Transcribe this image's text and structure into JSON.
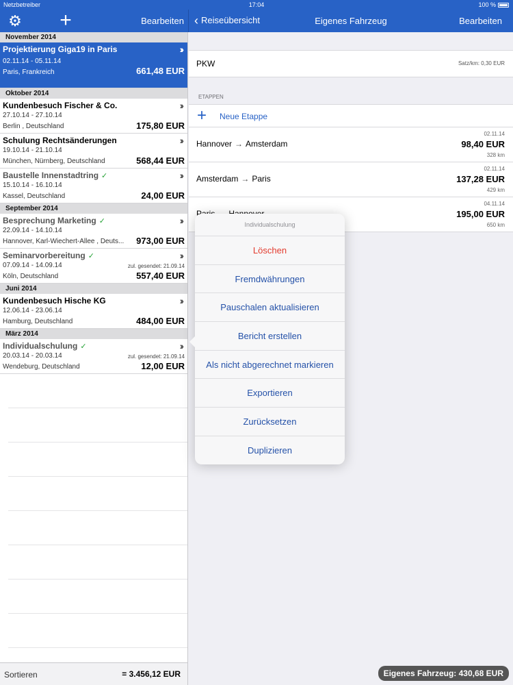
{
  "statusbar": {
    "carrier": "Netzbetreiber",
    "time": "17:04",
    "battery": "100 %"
  },
  "left_nav": {
    "edit_label": "Bearbeiten"
  },
  "right_nav": {
    "back_label": "Reiseübersicht",
    "title": "Eigenes Fahrzeug",
    "edit_label": "Bearbeiten"
  },
  "trips": {
    "sections": [
      {
        "header": "November 2014",
        "items": [
          {
            "title": "Projektierung Giga19 in Paris",
            "dates": "02.11.14 - 05.11.14",
            "place": "Paris, Frankreich",
            "amount": "661,48 EUR",
            "selected": true
          }
        ]
      },
      {
        "header": "Oktober 2014",
        "items": [
          {
            "title": "Kundenbesuch Fischer & Co.",
            "dates": "27.10.14 - 27.10.14",
            "place": "Berlin , Deutschland",
            "amount": "175,80 EUR"
          },
          {
            "title": "Schulung Rechtsänderungen",
            "dates": "19.10.14 - 21.10.14",
            "place": "München, Nürnberg, Deutschland",
            "amount": "568,44 EUR"
          },
          {
            "title": "Baustelle Innenstadtring",
            "dates": "15.10.14 - 16.10.14",
            "place": "Kassel, Deutschland",
            "amount": "24,00 EUR",
            "check": true
          }
        ]
      },
      {
        "header": "September 2014",
        "items": [
          {
            "title": "Besprechung Marketing",
            "dates": "22.09.14 - 14.10.14",
            "place": "Hannover, Karl-Wiechert-Allee , Deuts...",
            "amount": "973,00 EUR",
            "check": true
          },
          {
            "title": "Seminarvorbereitung",
            "dates": "07.09.14 - 14.09.14",
            "place": "Köln, Deutschland",
            "amount": "557,40 EUR",
            "check": true,
            "sent": "zul. gesendet: 21.09.14"
          }
        ]
      },
      {
        "header": "Juni 2014",
        "items": [
          {
            "title": "Kundenbesuch Hische KG",
            "dates": "12.06.14 - 23.06.14",
            "place": "Hamburg, Deutschland",
            "amount": "484,00 EUR"
          }
        ]
      },
      {
        "header": "März 2014",
        "items": [
          {
            "title": "Individualschulung",
            "dates": "20.03.14 - 20.03.14",
            "place": "Wendeburg, Deutschland",
            "amount": "12,00 EUR",
            "check": true,
            "sent": "zul. gesendet: 21.09.14"
          }
        ]
      }
    ]
  },
  "left_footer": {
    "sort_label": "Sortieren",
    "total": "= 3.456,12 EUR"
  },
  "vehicle": {
    "name": "PKW",
    "rate": "Satz/km: 0,30 EUR"
  },
  "stages": {
    "header": "ETAPPEN",
    "new_label": "Neue Etappe",
    "items": [
      {
        "from": "Hannover",
        "to": "Amsterdam",
        "date": "02.11.14",
        "amount": "98,40 EUR",
        "km": "328 km"
      },
      {
        "from": "Amsterdam",
        "to": "Paris",
        "date": "02.11.14",
        "amount": "137,28 EUR",
        "km": "429 km"
      },
      {
        "from": "Paris",
        "to": "Hannover",
        "date": "04.11.14",
        "amount": "195,00 EUR",
        "km": "650 km"
      }
    ]
  },
  "summary_badge": "Eigenes Fahrzeug: 430,68 EUR",
  "popover": {
    "title": "Individualschulung",
    "items": [
      {
        "label": "Löschen",
        "destructive": true
      },
      {
        "label": "Fremdwährungen"
      },
      {
        "label": "Pauschalen aktualisieren"
      },
      {
        "label": "Bericht erstellen"
      },
      {
        "label": "Als nicht abgerechnet markieren"
      },
      {
        "label": "Exportieren"
      },
      {
        "label": "Zurücksetzen"
      },
      {
        "label": "Duplizieren"
      }
    ]
  },
  "colors": {
    "accent": "#2862c6",
    "destructive": "#e33b2e",
    "check": "#26a236"
  }
}
